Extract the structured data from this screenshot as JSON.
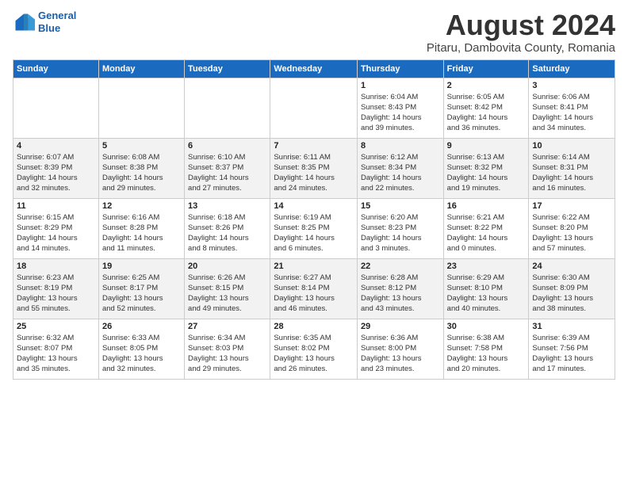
{
  "header": {
    "logo_line1": "General",
    "logo_line2": "Blue",
    "month": "August 2024",
    "location": "Pitaru, Dambovita County, Romania"
  },
  "weekdays": [
    "Sunday",
    "Monday",
    "Tuesday",
    "Wednesday",
    "Thursday",
    "Friday",
    "Saturday"
  ],
  "weeks": [
    [
      {
        "num": "",
        "info": ""
      },
      {
        "num": "",
        "info": ""
      },
      {
        "num": "",
        "info": ""
      },
      {
        "num": "",
        "info": ""
      },
      {
        "num": "1",
        "info": "Sunrise: 6:04 AM\nSunset: 8:43 PM\nDaylight: 14 hours\nand 39 minutes."
      },
      {
        "num": "2",
        "info": "Sunrise: 6:05 AM\nSunset: 8:42 PM\nDaylight: 14 hours\nand 36 minutes."
      },
      {
        "num": "3",
        "info": "Sunrise: 6:06 AM\nSunset: 8:41 PM\nDaylight: 14 hours\nand 34 minutes."
      }
    ],
    [
      {
        "num": "4",
        "info": "Sunrise: 6:07 AM\nSunset: 8:39 PM\nDaylight: 14 hours\nand 32 minutes."
      },
      {
        "num": "5",
        "info": "Sunrise: 6:08 AM\nSunset: 8:38 PM\nDaylight: 14 hours\nand 29 minutes."
      },
      {
        "num": "6",
        "info": "Sunrise: 6:10 AM\nSunset: 8:37 PM\nDaylight: 14 hours\nand 27 minutes."
      },
      {
        "num": "7",
        "info": "Sunrise: 6:11 AM\nSunset: 8:35 PM\nDaylight: 14 hours\nand 24 minutes."
      },
      {
        "num": "8",
        "info": "Sunrise: 6:12 AM\nSunset: 8:34 PM\nDaylight: 14 hours\nand 22 minutes."
      },
      {
        "num": "9",
        "info": "Sunrise: 6:13 AM\nSunset: 8:32 PM\nDaylight: 14 hours\nand 19 minutes."
      },
      {
        "num": "10",
        "info": "Sunrise: 6:14 AM\nSunset: 8:31 PM\nDaylight: 14 hours\nand 16 minutes."
      }
    ],
    [
      {
        "num": "11",
        "info": "Sunrise: 6:15 AM\nSunset: 8:29 PM\nDaylight: 14 hours\nand 14 minutes."
      },
      {
        "num": "12",
        "info": "Sunrise: 6:16 AM\nSunset: 8:28 PM\nDaylight: 14 hours\nand 11 minutes."
      },
      {
        "num": "13",
        "info": "Sunrise: 6:18 AM\nSunset: 8:26 PM\nDaylight: 14 hours\nand 8 minutes."
      },
      {
        "num": "14",
        "info": "Sunrise: 6:19 AM\nSunset: 8:25 PM\nDaylight: 14 hours\nand 6 minutes."
      },
      {
        "num": "15",
        "info": "Sunrise: 6:20 AM\nSunset: 8:23 PM\nDaylight: 14 hours\nand 3 minutes."
      },
      {
        "num": "16",
        "info": "Sunrise: 6:21 AM\nSunset: 8:22 PM\nDaylight: 14 hours\nand 0 minutes."
      },
      {
        "num": "17",
        "info": "Sunrise: 6:22 AM\nSunset: 8:20 PM\nDaylight: 13 hours\nand 57 minutes."
      }
    ],
    [
      {
        "num": "18",
        "info": "Sunrise: 6:23 AM\nSunset: 8:19 PM\nDaylight: 13 hours\nand 55 minutes."
      },
      {
        "num": "19",
        "info": "Sunrise: 6:25 AM\nSunset: 8:17 PM\nDaylight: 13 hours\nand 52 minutes."
      },
      {
        "num": "20",
        "info": "Sunrise: 6:26 AM\nSunset: 8:15 PM\nDaylight: 13 hours\nand 49 minutes."
      },
      {
        "num": "21",
        "info": "Sunrise: 6:27 AM\nSunset: 8:14 PM\nDaylight: 13 hours\nand 46 minutes."
      },
      {
        "num": "22",
        "info": "Sunrise: 6:28 AM\nSunset: 8:12 PM\nDaylight: 13 hours\nand 43 minutes."
      },
      {
        "num": "23",
        "info": "Sunrise: 6:29 AM\nSunset: 8:10 PM\nDaylight: 13 hours\nand 40 minutes."
      },
      {
        "num": "24",
        "info": "Sunrise: 6:30 AM\nSunset: 8:09 PM\nDaylight: 13 hours\nand 38 minutes."
      }
    ],
    [
      {
        "num": "25",
        "info": "Sunrise: 6:32 AM\nSunset: 8:07 PM\nDaylight: 13 hours\nand 35 minutes."
      },
      {
        "num": "26",
        "info": "Sunrise: 6:33 AM\nSunset: 8:05 PM\nDaylight: 13 hours\nand 32 minutes."
      },
      {
        "num": "27",
        "info": "Sunrise: 6:34 AM\nSunset: 8:03 PM\nDaylight: 13 hours\nand 29 minutes."
      },
      {
        "num": "28",
        "info": "Sunrise: 6:35 AM\nSunset: 8:02 PM\nDaylight: 13 hours\nand 26 minutes."
      },
      {
        "num": "29",
        "info": "Sunrise: 6:36 AM\nSunset: 8:00 PM\nDaylight: 13 hours\nand 23 minutes."
      },
      {
        "num": "30",
        "info": "Sunrise: 6:38 AM\nSunset: 7:58 PM\nDaylight: 13 hours\nand 20 minutes."
      },
      {
        "num": "31",
        "info": "Sunrise: 6:39 AM\nSunset: 7:56 PM\nDaylight: 13 hours\nand 17 minutes."
      }
    ]
  ]
}
